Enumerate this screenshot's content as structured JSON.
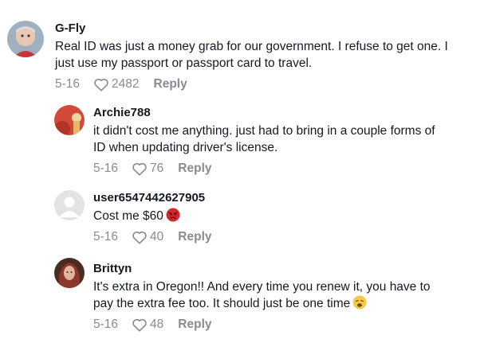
{
  "comments": [
    {
      "username": "G-Fly",
      "text_lines": [
        "Real ID was just a money grab for our government. I refuse to get one. I",
        "just use my passport or passport card to travel."
      ],
      "date": "5-16",
      "likes": "2482",
      "reply_label": "Reply"
    },
    {
      "username": "Archie788",
      "text_lines": [
        "it didn't cost me anything. just had to bring in a couple forms of",
        "ID when updating driver's license."
      ],
      "date": "5-16",
      "likes": "76",
      "reply_label": "Reply"
    },
    {
      "username": "user6547442627905",
      "text_lines": [
        "Cost me $60"
      ],
      "date": "5-16",
      "likes": "40",
      "reply_label": "Reply",
      "emoji": "angry-face-emoji"
    },
    {
      "username": "Brittyn",
      "text_lines": [
        "It's extra in Oregon!! And every time you renew it, you have to",
        "pay the extra fee too. It should just be one time"
      ],
      "date": "5-16",
      "likes": "48",
      "reply_label": "Reply",
      "emoji": "weary-face-emoji"
    }
  ],
  "colors": {
    "text": "#161823",
    "meta": "#8a8b91",
    "angry_emoji": "#d9262a",
    "weary_emoji": "#f7c948"
  },
  "icons": {
    "like": "heart-outline-icon"
  }
}
